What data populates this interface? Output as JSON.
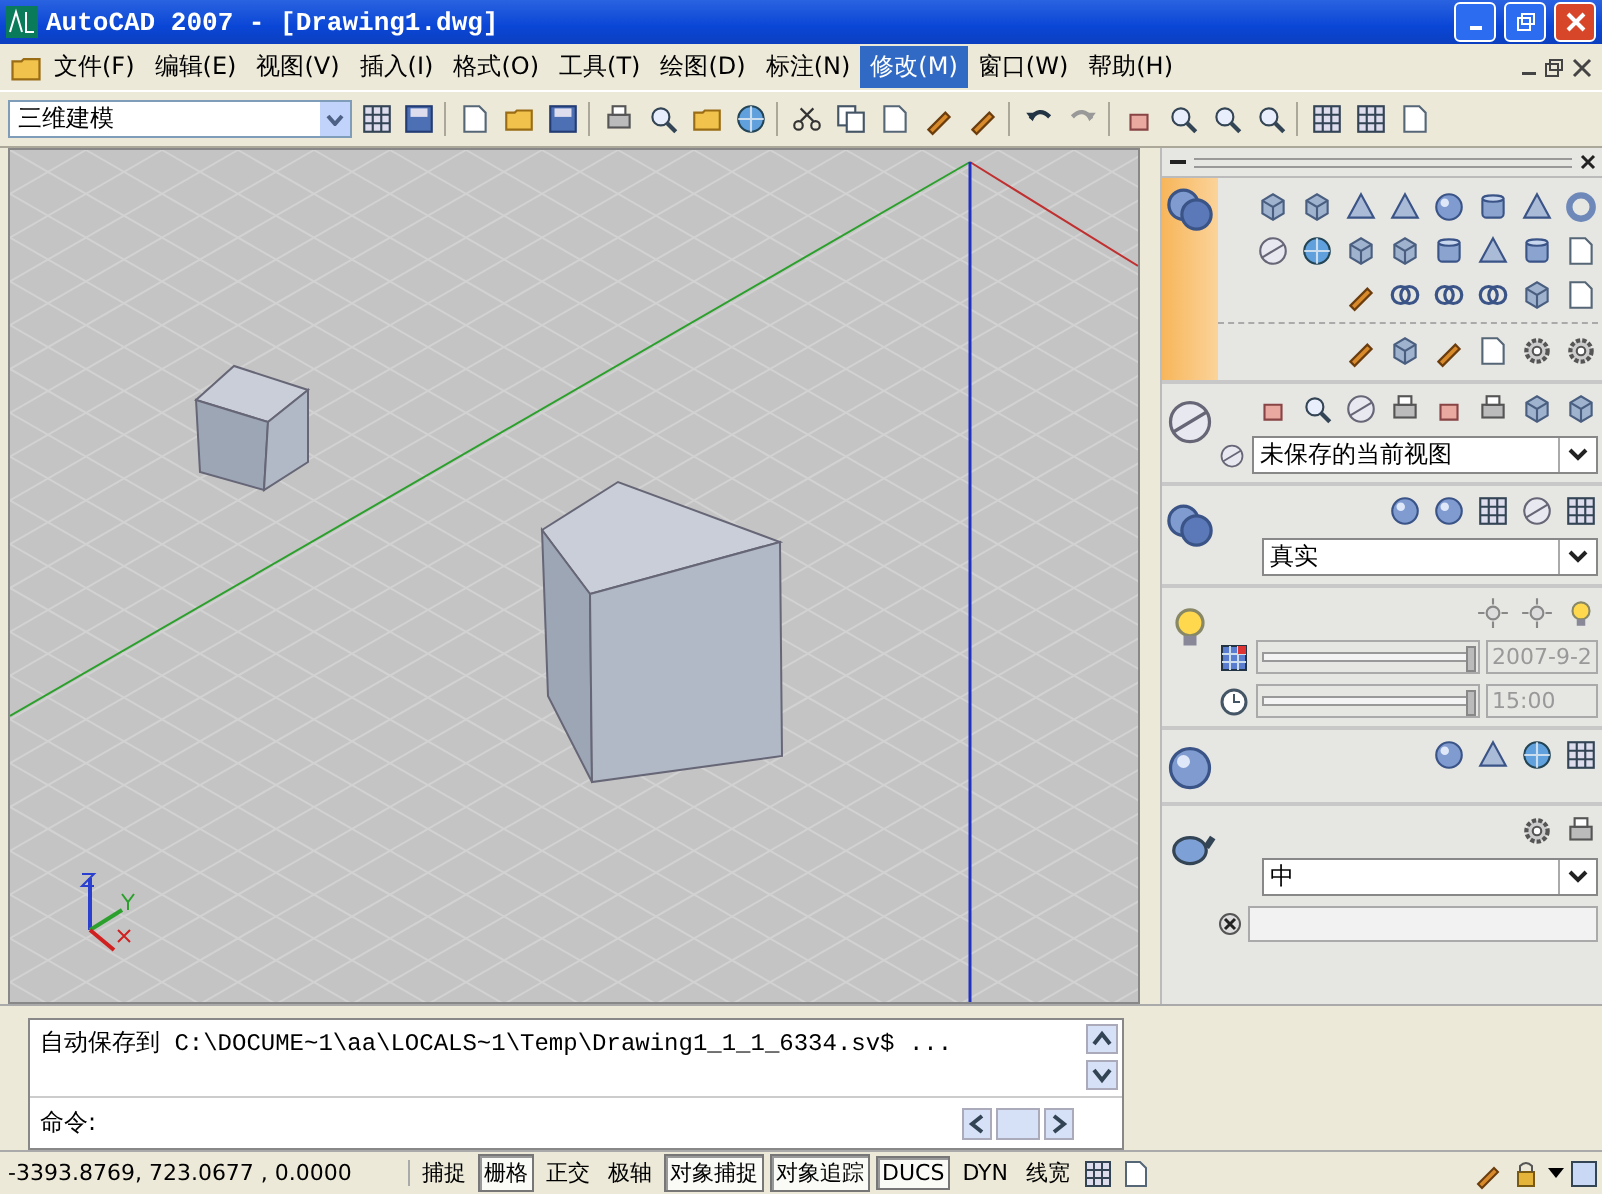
{
  "window": {
    "title": "AutoCAD 2007 - [Drawing1.dwg]"
  },
  "menu": [
    {
      "label": "文件(F)",
      "selected": false
    },
    {
      "label": "编辑(E)",
      "selected": false
    },
    {
      "label": "视图(V)",
      "selected": false
    },
    {
      "label": "插入(I)",
      "selected": false
    },
    {
      "label": "格式(O)",
      "selected": false
    },
    {
      "label": "工具(T)",
      "selected": false
    },
    {
      "label": "绘图(D)",
      "selected": false
    },
    {
      "label": "标注(N)",
      "selected": false
    },
    {
      "label": "修改(M)",
      "selected": true
    },
    {
      "label": "窗口(W)",
      "selected": false
    },
    {
      "label": "帮助(H)",
      "selected": false
    }
  ],
  "toolbar": {
    "workspace": "三维建模"
  },
  "dashboard": {
    "view_dropdown": "未保存的当前视图",
    "visual_style_dropdown": "真实",
    "date_slider": {
      "level": 1
    },
    "date": "2007-9-2",
    "time_slider": {
      "level": 1
    },
    "time": "15:00",
    "material_dropdown": "中"
  },
  "command_line": {
    "history": "自动保存到 C:\\DOCUME~1\\aa\\LOCALS~1\\Temp\\Drawing1_1_1_6334.sv$ ...",
    "prompt": "命令:"
  },
  "status_bar": {
    "coordinates": "-3393.8769, 723.0677 , 0.0000",
    "toggles": [
      {
        "label": "捕捉",
        "on": false
      },
      {
        "label": "栅格",
        "on": true
      },
      {
        "label": "正交",
        "on": false
      },
      {
        "label": "极轴",
        "on": false
      },
      {
        "label": "对象捕捉",
        "on": true
      },
      {
        "label": "对象追踪",
        "on": true
      },
      {
        "label": "DUCS",
        "on": true
      },
      {
        "label": "DYN",
        "on": false
      },
      {
        "label": "线宽",
        "on": false
      }
    ]
  }
}
